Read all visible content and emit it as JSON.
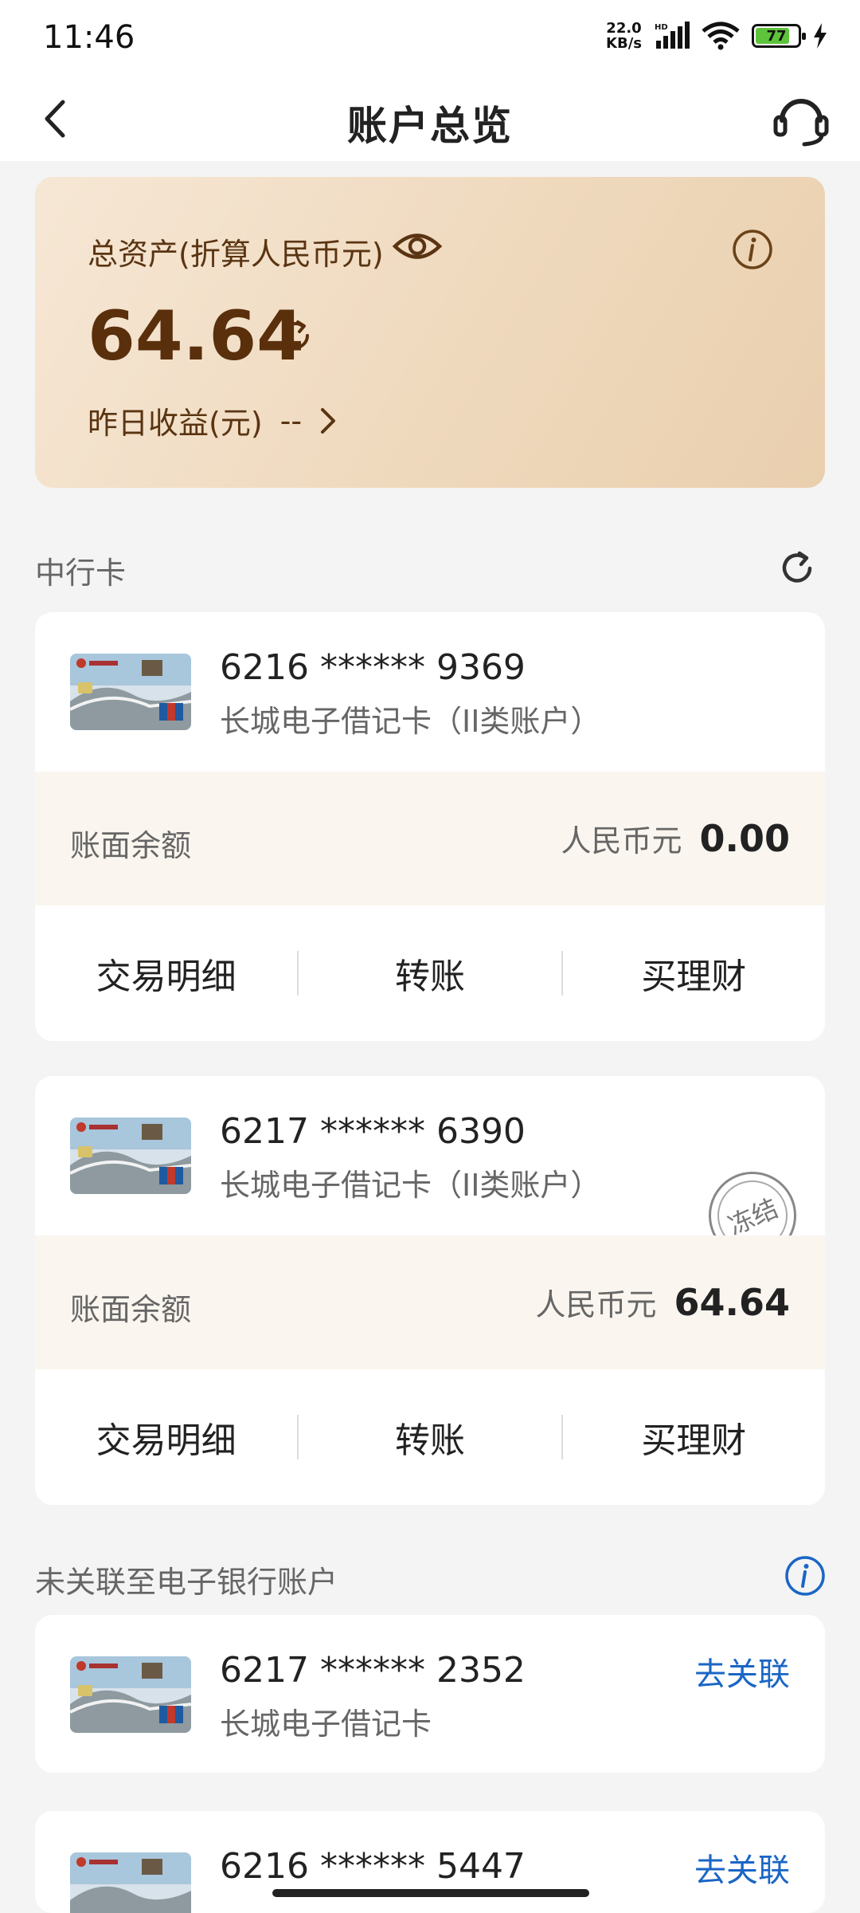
{
  "status_bar": {
    "time": "11:46",
    "net_speed_value": "22.0",
    "net_speed_unit": "KB/s",
    "battery": "77"
  },
  "header": {
    "title": "账户总览"
  },
  "asset_card": {
    "label": "总资产(折算人民币元)",
    "amount": "64.64",
    "yesterday_label": "昨日收益(元)",
    "yesterday_value": "--"
  },
  "section_boc": {
    "title": "中行卡"
  },
  "accounts": [
    {
      "card_number": "6216 ****** 9369",
      "card_type": "长城电子借记卡（II类账户）",
      "balance_label": "账面余额",
      "currency": "人民币元",
      "balance": "0.00",
      "frozen": false,
      "actions": [
        "交易明细",
        "转账",
        "买理财"
      ]
    },
    {
      "card_number": "6217 ****** 6390",
      "card_type": "长城电子借记卡（II类账户）",
      "balance_label": "账面余额",
      "currency": "人民币元",
      "balance": "64.64",
      "frozen": true,
      "frozen_label": "冻结",
      "actions": [
        "交易明细",
        "转账",
        "买理财"
      ]
    }
  ],
  "section_unlinked": {
    "title": "未关联至电子银行账户"
  },
  "unlinked_accounts": [
    {
      "card_number": "6217 ****** 2352",
      "card_type": "长城电子借记卡",
      "link_label": "去关联"
    },
    {
      "card_number": "6216 ****** 5447",
      "link_label": "去关联"
    }
  ],
  "colors": {
    "asset_card_gradient_start": "#f6e7d5",
    "asset_card_gradient_end": "#e9cfae",
    "asset_text": "#5a2f0c",
    "link_blue": "#1a66c5",
    "balance_row_bg": "#faf6ef"
  }
}
